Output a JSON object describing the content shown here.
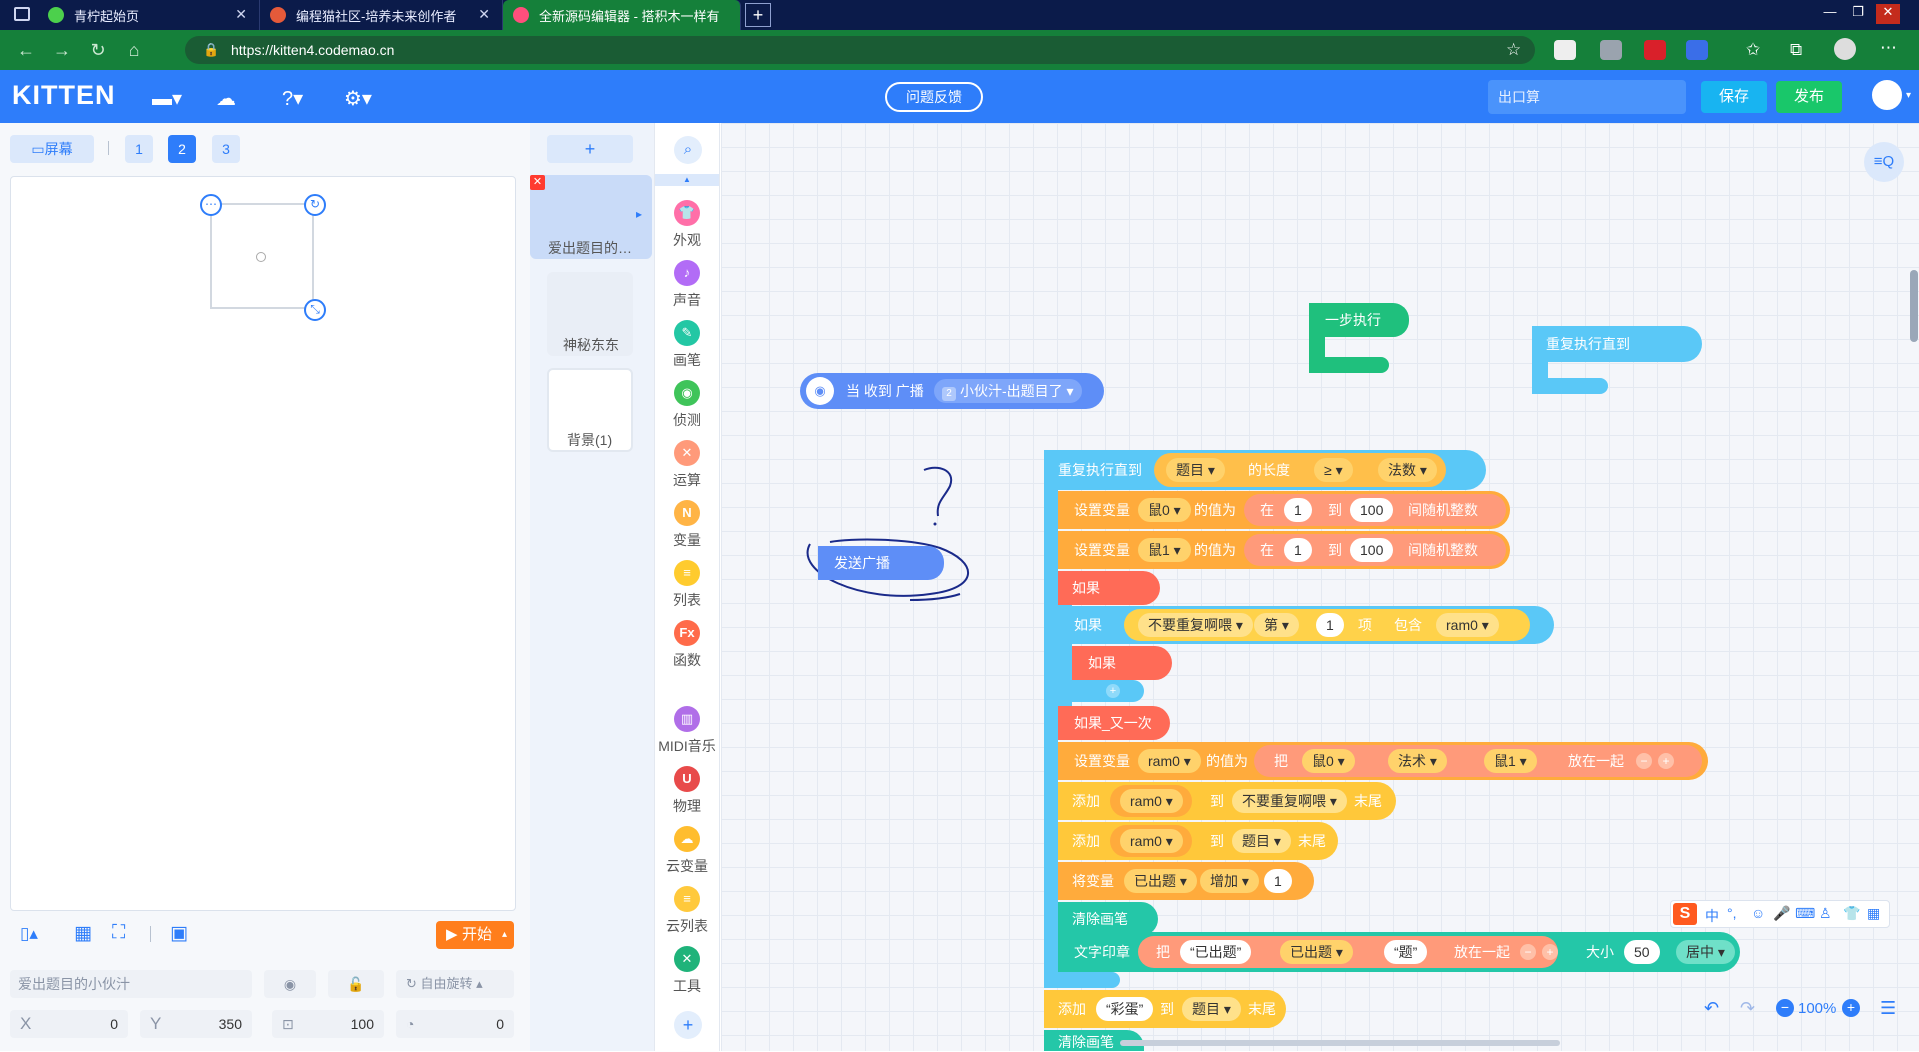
{
  "browser": {
    "tabs": [
      {
        "title": "青柠起始页",
        "color": "#4cd04c"
      },
      {
        "title": "编程猫社区-培养未来创作者",
        "color": "#e55a3a"
      },
      {
        "title": "全新源码编辑器 - 搭积木一样有趣",
        "color": "#ff4f7c"
      }
    ],
    "url": "https://kitten4.codemao.cn"
  },
  "app": {
    "logo": "KITTEN",
    "feedback": "问题反馈",
    "project_name": "出口算",
    "save": "保存",
    "publish": "发布"
  },
  "stage": {
    "screen_btn": "屏幕",
    "pages": [
      "1",
      "2",
      "3"
    ],
    "start": "开始",
    "sprite_name": "爱出题目的小伙汁",
    "rotate_mode": "自由旋转",
    "x_label": "X",
    "x_val": "0",
    "y_label": "Y",
    "y_val": "350",
    "size_val": "100",
    "rot_val": "0"
  },
  "sprites": {
    "add": "+",
    "items": [
      "爱出题目的…",
      "神秘东东",
      "背景(1)"
    ]
  },
  "categories": [
    {
      "label": "外观",
      "color": "#ff6fa8"
    },
    {
      "label": "声音",
      "color": "#b26cf6"
    },
    {
      "label": "画笔",
      "color": "#23c7a4"
    },
    {
      "label": "侦测",
      "color": "#3fc45a"
    },
    {
      "label": "运算",
      "color": "#ff9a7a"
    },
    {
      "label": "变量",
      "color": "#ffb445"
    },
    {
      "label": "列表",
      "color": "#ffcb2e"
    },
    {
      "label": "函数",
      "color": "#ff6b4a"
    },
    {
      "label": "MIDI音乐",
      "color": "#b06ee8"
    },
    {
      "label": "物理",
      "color": "#e84a4a"
    },
    {
      "label": "云变量",
      "color": "#ffbd2e"
    },
    {
      "label": "云列表",
      "color": "#ffc93c"
    },
    {
      "label": "工具",
      "color": "#1fb37a"
    }
  ],
  "blocks": {
    "step": "一步执行",
    "repeat_until_a": "重复执行直到",
    "when_recv": "当 收到 广播",
    "recv_num": "2",
    "recv_msg": "小伙汁-出题目了",
    "broadcast": "发送广播",
    "repeat_until": "重复执行直到",
    "r_var": "题目",
    "r_len": "的长度",
    "r_op": "≥",
    "r_rhs": "法数",
    "set1": "设置变量",
    "set1_var": "鼠0",
    "value_of": "的值为",
    "in": "在",
    "n1": "1",
    "to": "到",
    "n100": "100",
    "rand": "间随机整数",
    "set2_var": "鼠1",
    "if1": "如果",
    "if2": "如果",
    "list_name": "不要重复啊喂",
    "index": "第",
    "idx_n": "1",
    "item": "项",
    "contains": "包含",
    "ram": "ram0",
    "if3": "如果",
    "if_else": "如果_又一次",
    "join": "把",
    "j1": "鼠0",
    "j2": "法术",
    "j3": "鼠1",
    "put_together": "放在一起",
    "add": "添加",
    "to2": "到",
    "end": "末尾",
    "list_q": "题目",
    "change": "将变量",
    "done_var": "已出题",
    "incr": "增加",
    "incr_n": "1",
    "clear": "清除画笔",
    "print": "文字印章",
    "s1": "已出题",
    "s2": "题",
    "size": "大小",
    "size_n": "50",
    "align": "居中",
    "egg": "彩蛋",
    "zoom": "100%"
  },
  "ime": {
    "label": "中"
  }
}
